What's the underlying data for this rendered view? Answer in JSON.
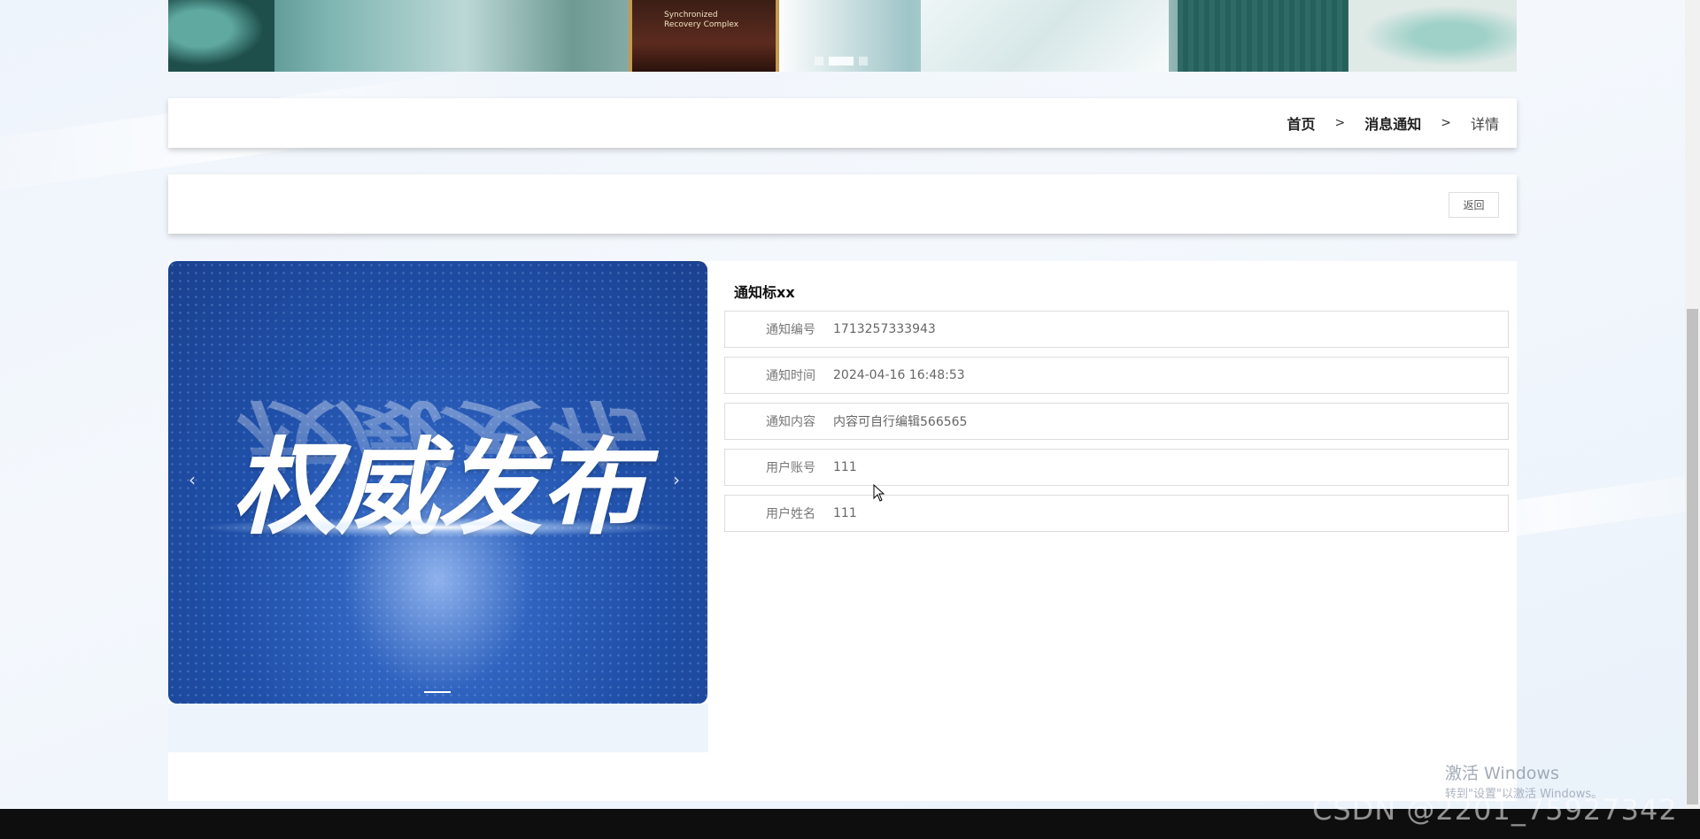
{
  "banner": {
    "bottle_label": "Synchronized\nRecovery Complex",
    "slide_count": 3,
    "active_slide": 2
  },
  "breadcrumb": {
    "home": "首页",
    "separator": ">",
    "section": "消息通知",
    "current": "详情"
  },
  "actions": {
    "back_label": "返回"
  },
  "carousel": {
    "headline": "权威发布",
    "prev_arrow": "‹",
    "next_arrow": "›"
  },
  "notice": {
    "title": "通知标xx",
    "fields": [
      {
        "label": "通知编号",
        "value": "1713257333943"
      },
      {
        "label": "通知时间",
        "value": "2024-04-16 16:48:53"
      },
      {
        "label": "通知内容",
        "value": "内容可自行编辑566565"
      },
      {
        "label": "用户账号",
        "value": "111"
      },
      {
        "label": "用户姓名",
        "value": "111"
      }
    ]
  },
  "system": {
    "activate_title": "激活 Windows",
    "activate_sub": "转到\"设置\"以激活 Windows。",
    "csdn_watermark": "CSDN @2201_75927342"
  },
  "colors": {
    "carousel_blue": "#1f4fa8",
    "page_bg": "#eef4fb",
    "border": "#dddddd"
  }
}
